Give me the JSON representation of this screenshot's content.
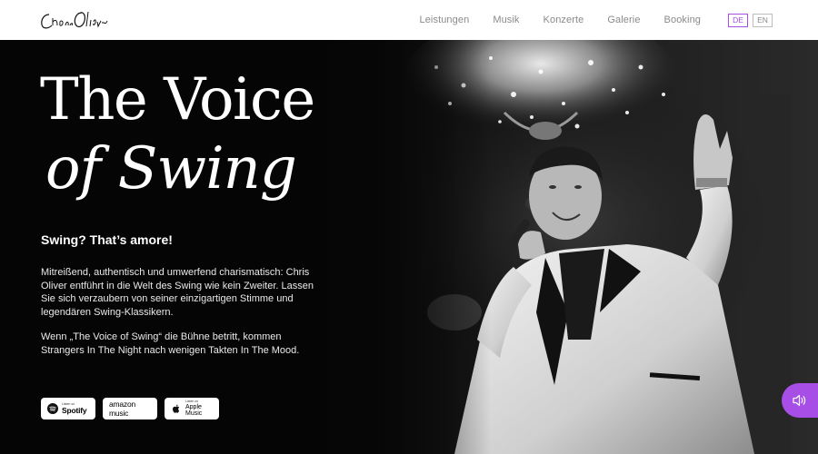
{
  "header": {
    "logo_text": "Chris Oliver",
    "nav": [
      "Leistungen",
      "Musik",
      "Konzerte",
      "Galerie",
      "Booking"
    ],
    "languages": [
      {
        "label": "DE",
        "active": true
      },
      {
        "label": "EN",
        "active": false
      }
    ],
    "accent_color": "#a64ee6"
  },
  "hero": {
    "title_line1": "The Voice",
    "title_line2": "of Swing",
    "tagline": "Swing? That’s amore!",
    "paragraph1": "Mitreißend, authentisch und umwerfend charismatisch: Chris Oliver entführt in die Welt des Swing wie kein Zweiter. Lassen Sie sich verzaubern von seiner einzigartigen Stimme und legendären Swing-Klassikern.",
    "paragraph2": "Wenn „The Voice of Swing“ die Bühne betritt, kommen Strangers In The Night nach wenigen Takten In The Mood.",
    "badges": {
      "spotify_small": "Listen on",
      "spotify": "Spotify",
      "amazon": "amazon music",
      "apple_small": "Listen on",
      "apple": "Apple Music"
    },
    "audio_button_icon": "speaker-icon"
  }
}
